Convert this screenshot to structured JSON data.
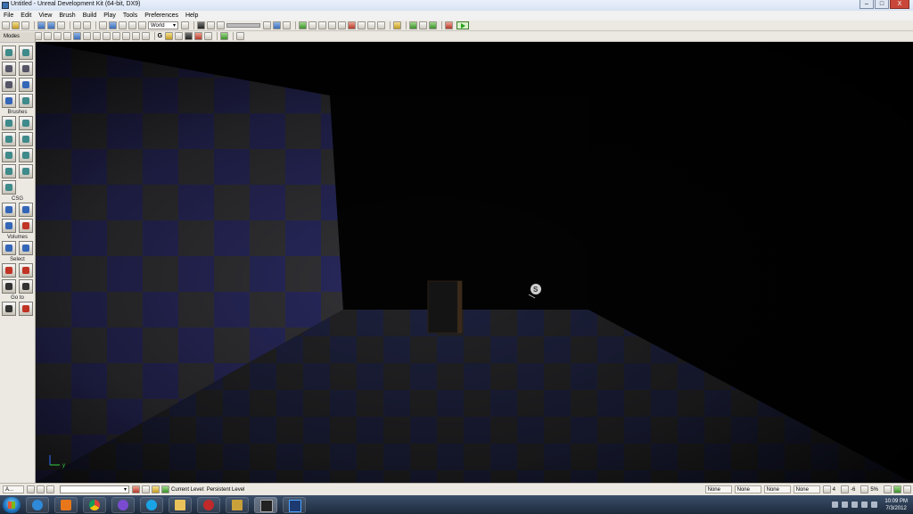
{
  "window": {
    "title": "Untitled - Unreal Development Kit (64-bit, DX9)",
    "buttons": [
      "–",
      "□",
      "X"
    ]
  },
  "menu": [
    "File",
    "Edit",
    "View",
    "Brush",
    "Build",
    "Play",
    "Tools",
    "Preferences",
    "Help"
  ],
  "toolbar": {
    "coord_system": "World"
  },
  "toolbar2": {
    "p_label": "P",
    "g_label": "G"
  },
  "modes": {
    "header": "Modes",
    "sections": [
      "Brushes",
      "CSG",
      "Volumes",
      "Select",
      "Go to"
    ]
  },
  "viewport": {
    "axis_x": "x",
    "axis_y": "y",
    "sound_label": "S"
  },
  "status": {
    "panel_label": "A...",
    "current_level_label": "Current Level:",
    "current_level_value": "Persistent Level",
    "fields": [
      "None",
      "None",
      "None",
      "None"
    ],
    "grid": "4",
    "rotation_snap": "-6",
    "scale_snap": "5%"
  },
  "clock": {
    "time": "10:09 PM",
    "date": "7/3/2012"
  },
  "taskbar": {
    "apps": [
      "internet-explorer",
      "media-player",
      "chrome",
      "browser",
      "skype",
      "explorer",
      "app",
      "app",
      "udk",
      "photoshop"
    ],
    "udk_label": "UDK",
    "ps_label": "Ps"
  }
}
